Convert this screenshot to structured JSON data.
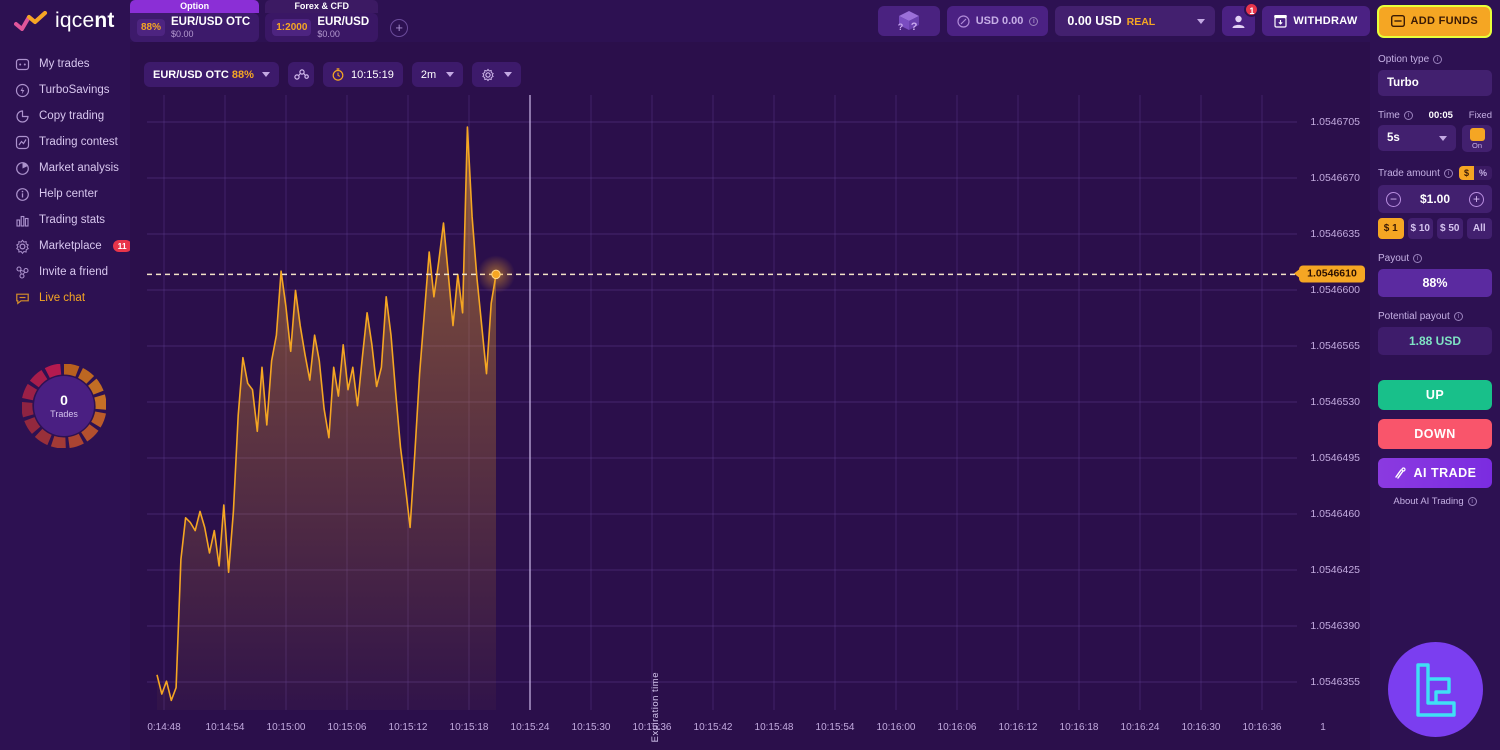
{
  "brand": {
    "name_light": "iqce",
    "name_bold": "nt"
  },
  "asset_tabs": [
    {
      "head": "Option",
      "badge": "88%",
      "name": "EUR/USD OTC",
      "sub": "$0.00",
      "type": "option"
    },
    {
      "head": "Forex & CFD",
      "badge": "1:2000",
      "name": "EUR/USD",
      "sub": "$0.00",
      "type": "forex"
    }
  ],
  "topbar": {
    "add_tab_icon": "plus-icon",
    "gift_box": {
      "icon": "gift-box-icon",
      "q1": "?",
      "q2": "?"
    },
    "demo_balance": "USD 0.00",
    "balance_amount": "0.00 USD",
    "balance_type": "REAL",
    "notifications_count": "1",
    "withdraw_label": "WITHDRAW",
    "add_funds_label": "ADD FUNDS"
  },
  "sidebar": {
    "items": [
      {
        "label": "My trades",
        "icon": "my-trades-icon"
      },
      {
        "label": "TurboSavings",
        "icon": "turbo-savings-icon"
      },
      {
        "label": "Copy trading",
        "icon": "copy-trading-icon"
      },
      {
        "label": "Trading contest",
        "icon": "trading-contest-icon"
      },
      {
        "label": "Market analysis",
        "icon": "market-analysis-icon"
      },
      {
        "label": "Help center",
        "icon": "help-center-icon"
      },
      {
        "label": "Trading stats",
        "icon": "trading-stats-icon"
      },
      {
        "label": "Marketplace",
        "icon": "marketplace-icon",
        "badge": "11"
      },
      {
        "label": "Invite a friend",
        "icon": "invite-friend-icon"
      },
      {
        "label": "Live chat",
        "icon": "live-chat-icon",
        "highlight": true
      }
    ],
    "trades_widget": {
      "value": "0",
      "label": "Trades"
    }
  },
  "chart_toolbar": {
    "asset": "EUR/USD OTC",
    "asset_percent": "88%",
    "indicators_icon": "indicators-icon",
    "clock_time": "10:15:19",
    "timeframe": "2m",
    "settings_icon": "gear-icon"
  },
  "chart_data": {
    "type": "area",
    "title": "EUR/USD OTC",
    "xlabel": "",
    "ylabel": "",
    "grid": true,
    "legend": "none",
    "ylim": [
      1.0546338,
      1.0546722
    ],
    "y_ticks": [
      "1.0546705",
      "1.0546670",
      "1.0546635",
      "1.0546600",
      "1.0546565",
      "1.0546530",
      "1.0546495",
      "1.0546460",
      "1.0546425",
      "1.0546390",
      "1.0546355"
    ],
    "x_ticks": [
      "0:14:48",
      "10:14:54",
      "10:15:00",
      "10:15:06",
      "10:15:12",
      "10:15:18",
      "10:15:24",
      "10:15:30",
      "10:15:36",
      "10:15:42",
      "10:15:48",
      "10:15:54",
      "10:16:00",
      "10:16:06",
      "10:16:12",
      "10:16:18",
      "10:16:24",
      "10:16:30",
      "10:16:36",
      "1"
    ],
    "current_price": "1.0546610",
    "current_price_y": 1.054661,
    "expiration_label": "Expiration time",
    "expiration_time": "10:15:24",
    "line_color": "#f5a623",
    "series": [
      {
        "name": "EUR/USD OTC",
        "values": [
          1.054636,
          1.0546348,
          1.0546356,
          1.0546344,
          1.0546352,
          1.0546432,
          1.0546458,
          1.0546455,
          1.054645,
          1.0546462,
          1.0546452,
          1.0546436,
          1.054645,
          1.0546428,
          1.0546466,
          1.0546424,
          1.0546462,
          1.0546522,
          1.0546558,
          1.0546542,
          1.0546538,
          1.0546512,
          1.0546552,
          1.0546516,
          1.0546556,
          1.0546572,
          1.0546612,
          1.054659,
          1.0546562,
          1.05466,
          1.0546578,
          1.054656,
          1.0546544,
          1.0546572,
          1.0546556,
          1.0546526,
          1.0546508,
          1.0546552,
          1.0546534,
          1.0546566,
          1.0546538,
          1.0546552,
          1.0546528,
          1.0546558,
          1.0546586,
          1.0546566,
          1.054654,
          1.0546552,
          1.0546596,
          1.0546572,
          1.0546536,
          1.0546502,
          1.0546478,
          1.0546452,
          1.0546498,
          1.0546548,
          1.0546586,
          1.0546624,
          1.0546596,
          1.0546618,
          1.0546642,
          1.054661,
          1.0546578,
          1.054661,
          1.0546586,
          1.0546702,
          1.0546646,
          1.0546608,
          1.0546578,
          1.0546548,
          1.0546592,
          1.054661
        ]
      }
    ]
  },
  "right_panel": {
    "option_type_label": "Option type",
    "option_type_value": "Turbo",
    "time_label": "Time",
    "time_countdown": "00:05",
    "fixed_label": "Fixed",
    "time_value": "5s",
    "toggle_state": "On",
    "trade_amount_label": "Trade amount",
    "currency_symbol": "$",
    "percent_symbol": "%",
    "trade_amount_value": "$1.00",
    "quick_amounts": [
      "$ 1",
      "$ 10",
      "$ 50",
      "All"
    ],
    "payout_label": "Payout",
    "payout_value": "88%",
    "potential_payout_label": "Potential payout",
    "potential_payout_value": "1.88 USD",
    "up_label": "UP",
    "down_label": "DOWN",
    "ai_trade_label": "AI TRADE",
    "about_ai_label": "About AI Trading"
  }
}
